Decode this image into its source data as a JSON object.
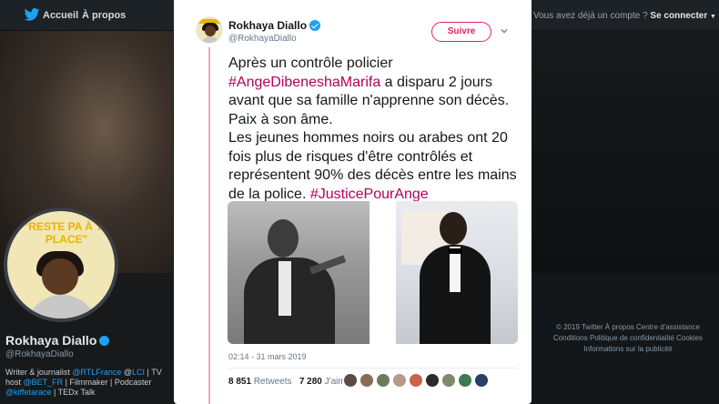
{
  "topbar": {
    "home_label": "Accueil",
    "about_label": "À propos",
    "have_account": "Vous avez déjà un compte ?",
    "login_label": "Se connecter"
  },
  "profile": {
    "name": "Rokhaya Diallo",
    "handle": "@RokhayaDiallo",
    "avatar_banner": "\"RESTE PA À TA PLACE\"",
    "bio_prefix": "Writer & journalist",
    "bio_link1": "@RTLFrance",
    "bio_sep": " @",
    "bio_link2": "LCI",
    "bio_mid": " | TV host ",
    "bio_link3": "@BET_FR",
    "bio_mid2": " | Filmmaker | Podcaster ",
    "bio_link4": "@kiffetarace",
    "bio_end": " | TEDx Talk"
  },
  "footer": {
    "line1": "© 2019 Twitter   À propos   Centre d'assistance",
    "line2": "Conditions   Politique de confidentialité   Cookies",
    "line3": "Informations sur la publicité"
  },
  "tweet": {
    "author_name": "Rokhaya Diallo",
    "author_handle": "@RokhayaDiallo",
    "follow_label": "Suivre",
    "text_1": "Après un contrôle policier ",
    "hashtag_1": "#AngeDibeneshaMarifa",
    "text_2": " a disparu 2 jours avant que sa famille n'apprenne son décès. Paix à son âme.",
    "text_3": "Les jeunes hommes noirs ou arabes ont 20 fois plus de risques d'être contrôlés et représentent 90% des décès entre les mains de la police. ",
    "hashtag_2": "#JusticePourAnge",
    "timestamp": "02:14 - 31 mars 2019",
    "retweets_count": "8 851",
    "retweets_label": "Retweets",
    "likes_count": "7 280",
    "likes_label": "J'aime"
  },
  "colors": {
    "accent": "#e0245e",
    "hashtag": "#b4005b",
    "verified": "#1da1f2"
  },
  "icons": [
    "twitter-bird-icon",
    "verified-badge-icon",
    "chevron-down-icon"
  ]
}
